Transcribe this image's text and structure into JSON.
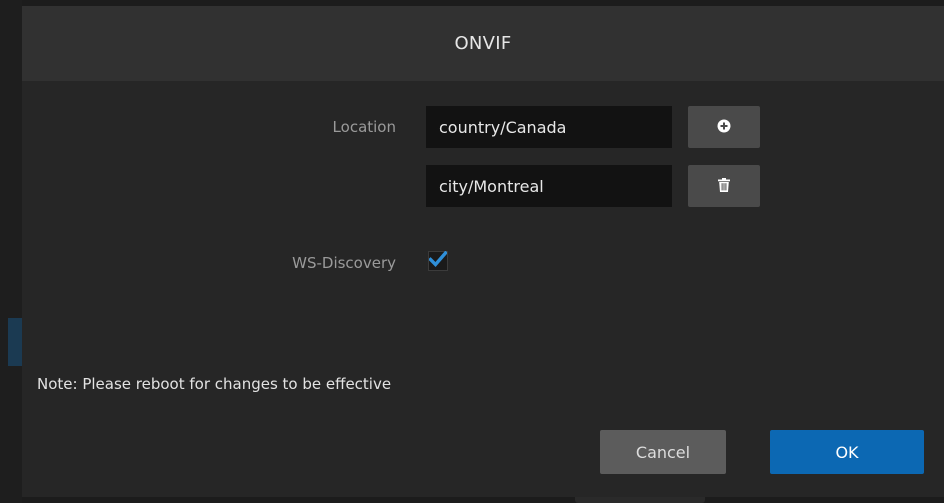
{
  "dialog": {
    "title": "ONVIF",
    "location_label": "Location",
    "location_values": [
      "country/Canada",
      "city/Montreal"
    ],
    "add_icon": "plus-circle-icon",
    "delete_icon": "trash-icon",
    "ws_discovery_label": "WS-Discovery",
    "ws_discovery_checked": true,
    "note": "Note: Please reboot for changes to be effective",
    "cancel_label": "Cancel",
    "ok_label": "OK"
  },
  "colors": {
    "accent": "#0c68b3",
    "checkmark": "#2f8fd8"
  }
}
